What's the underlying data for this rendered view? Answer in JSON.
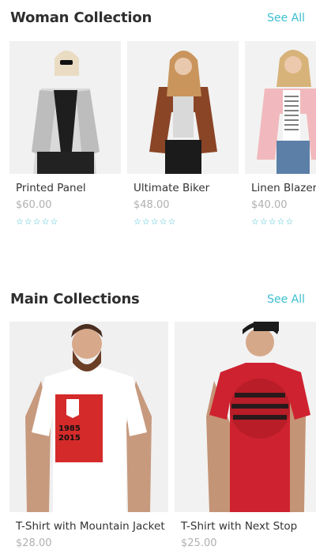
{
  "sections": [
    {
      "title": "Woman Collection",
      "see_all": "See All",
      "products": [
        {
          "name": "Printed Panel",
          "price": "$60.00",
          "rating": "☆☆☆☆☆"
        },
        {
          "name": "Ultimate Biker",
          "price": "$48.00",
          "rating": "☆☆☆☆☆"
        },
        {
          "name": "Linen Blazer",
          "price": "$40.00",
          "rating": "☆☆☆☆☆"
        }
      ]
    },
    {
      "title": "Main Collections",
      "see_all": "See All",
      "products": [
        {
          "name": "T-Shirt with Mountain Jacket",
          "price": "$28.00",
          "print": "1985\n2015"
        },
        {
          "name": "T-Shirt with Next Stop",
          "price": "$25.00"
        }
      ]
    }
  ],
  "colors": {
    "accent": "#3cbfcf",
    "photo_bg": "#f0f0f0",
    "tee_red": "#d42a2a"
  }
}
